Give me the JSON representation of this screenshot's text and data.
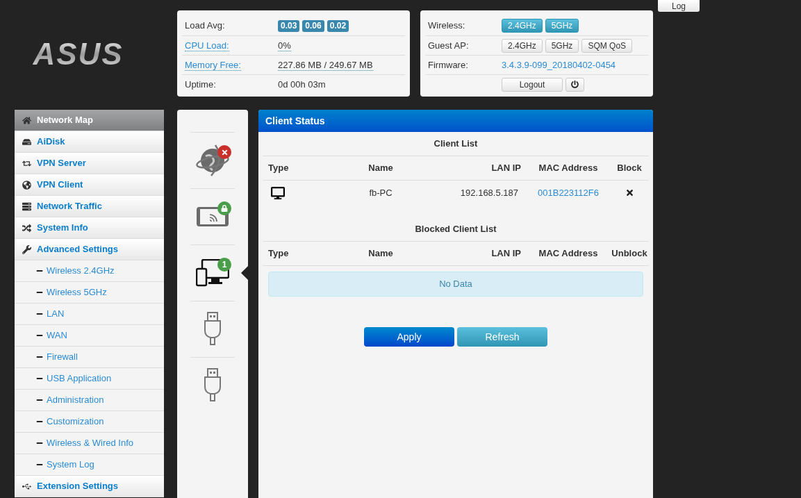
{
  "logo": {
    "text": "ASUS"
  },
  "log_button": {
    "label": "Log"
  },
  "status_left": [
    {
      "kind": "badges",
      "label": "Load Avg:",
      "values": [
        "0.03",
        "0.06",
        "0.02"
      ]
    },
    {
      "kind": "link",
      "label": "CPU Load:",
      "value": "0%"
    },
    {
      "kind": "link",
      "label": "Memory Free:",
      "value": "227.86 MB / 249.67 MB"
    },
    {
      "kind": "plain",
      "label": "Uptime:",
      "value": "0d 00h 03m"
    }
  ],
  "status_right": [
    {
      "kind": "toggles",
      "label": "Wireless:",
      "buttons": [
        {
          "label": "2.4GHz",
          "on": true
        },
        {
          "label": "5GHz",
          "on": true
        }
      ]
    },
    {
      "kind": "toggles",
      "label": "Guest AP:",
      "buttons": [
        {
          "label": "2.4GHz",
          "on": false
        },
        {
          "label": "5GHz",
          "on": false
        },
        {
          "label": "SQM QoS",
          "on": false
        }
      ]
    },
    {
      "kind": "firmware",
      "label": "Firmware:",
      "value": "3.4.3.9-099_20180402-0454"
    },
    {
      "kind": "actions",
      "buttons": [
        {
          "label": "Logout"
        }
      ]
    }
  ],
  "sidebar": {
    "items": [
      {
        "label": "Network Map",
        "selected": true
      },
      {
        "label": "AiDisk",
        "selected": false
      },
      {
        "label": "VPN Server",
        "selected": false
      },
      {
        "label": "VPN Client",
        "selected": false
      },
      {
        "label": "Network Traffic",
        "selected": false
      },
      {
        "label": "System Info",
        "selected": false
      },
      {
        "label": "Advanced Settings",
        "selected": false,
        "children": [
          {
            "label": "Wireless 2.4GHz",
            "selected": false
          },
          {
            "label": "Wireless 5GHz",
            "selected": false
          },
          {
            "label": "LAN",
            "selected": false
          },
          {
            "label": "WAN",
            "selected": false
          },
          {
            "label": "Firewall",
            "selected": false
          },
          {
            "label": "USB Application",
            "selected": false
          },
          {
            "label": "Administration",
            "selected": false
          },
          {
            "label": "Customization",
            "selected": false
          },
          {
            "label": "Wireless & Wired Info",
            "selected": false
          },
          {
            "label": "System Log",
            "selected": false
          }
        ]
      },
      {
        "label": "Extension Settings",
        "selected": false
      }
    ]
  },
  "devices": [
    {
      "kind": "internet",
      "selected": false
    },
    {
      "kind": "wireless",
      "selected": false
    },
    {
      "kind": "clients",
      "count": "1",
      "selected": true
    },
    {
      "kind": "usb",
      "selected": false
    },
    {
      "kind": "usb",
      "selected": false
    }
  ],
  "panel": {
    "title": "Client Status",
    "client_list": {
      "title": "Client List",
      "columns": [
        "Type",
        "Name",
        "LAN IP",
        "MAC Address",
        "Block"
      ],
      "rows": [
        {
          "name": "fb-PC",
          "lan_ip": "192.168.5.187",
          "mac": "001B223112F6"
        }
      ]
    },
    "blocked_list": {
      "title": "Blocked Client List",
      "columns": [
        "Type",
        "Name",
        "LAN IP",
        "MAC Address",
        "Unblock"
      ],
      "empty": "No Data"
    },
    "buttons": [
      {
        "label": "Apply",
        "kind": "primary"
      },
      {
        "label": "Refresh",
        "kind": "info"
      }
    ]
  }
}
